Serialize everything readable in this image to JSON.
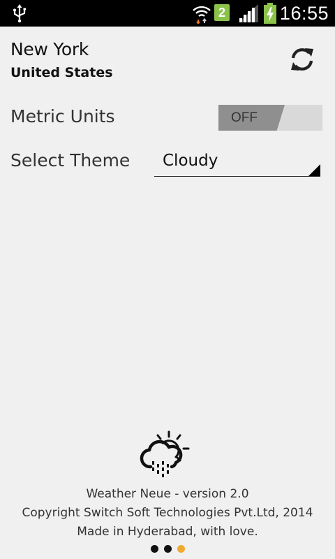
{
  "status_bar": {
    "time": "16:55",
    "sim_slot": "2",
    "icons": [
      "usb-icon",
      "wifi-icon",
      "sim-badge",
      "signal-icon",
      "battery-charging-icon"
    ]
  },
  "header": {
    "city": "New York",
    "country": "United States",
    "refresh_icon": "refresh-icon"
  },
  "settings": {
    "metric_units": {
      "label": "Metric Units",
      "toggle_text": "OFF",
      "enabled": false
    },
    "theme": {
      "label": "Select Theme",
      "selected": "Cloudy"
    }
  },
  "footer": {
    "logo_icon": "cloud-rain-sun-icon",
    "version": "Weather Neue - version 2.0",
    "copyright": "Copyright Switch Soft Technologies Pvt.Ltd, 2014",
    "made_in": "Made in Hyderabad, with love."
  },
  "pager": {
    "count": 3,
    "active_index": 2
  },
  "colors": {
    "status_bar_bg": "#000000",
    "page_bg": "#f0f0f0",
    "toggle_thumb": "#8f8f8f",
    "toggle_track": "#d9d9d9",
    "sim_badge": "#8bc34a",
    "pager_active": "#f0a830"
  }
}
